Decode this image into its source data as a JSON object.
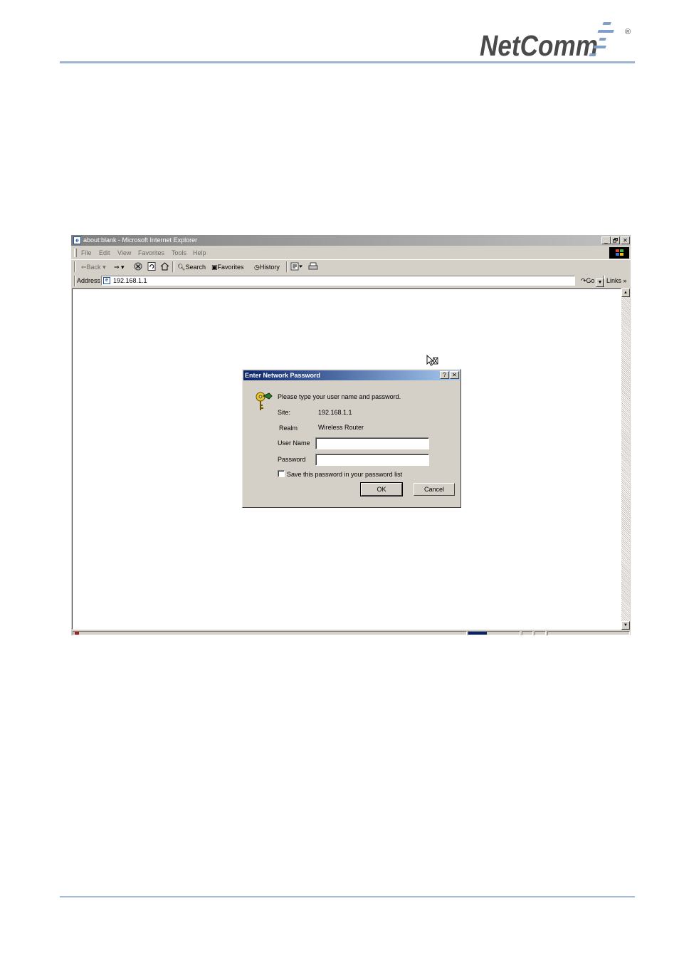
{
  "document": {
    "brand": "NetComm",
    "registered_mark": "®"
  },
  "browser": {
    "title": "about:blank - Microsoft Internet Explorer",
    "window_buttons": {
      "minimize": "_",
      "maximize": "🗗",
      "close": "✕"
    },
    "menu": [
      "File",
      "Edit",
      "View",
      "Favorites",
      "Tools",
      "Help"
    ],
    "toolbar": {
      "back": "Back",
      "search": "Search",
      "favorites": "Favorites",
      "history": "History"
    },
    "address": {
      "label": "Address",
      "value": "192.168.1.1",
      "go": "Go",
      "links": "Links"
    }
  },
  "dialog": {
    "title": "Enter Network Password",
    "help": "?",
    "close": "✕",
    "prompt": "Please type your user name and password.",
    "site_label": "Site:",
    "site_value": "192.168.1.1",
    "realm_label": "Realm",
    "realm_value": "Wireless Router",
    "username_label": "User Name",
    "username_value": "",
    "password_label": "Password",
    "password_value": "",
    "save_password_label": "Save this password in your password list",
    "save_password_checked": false,
    "ok_label": "OK",
    "cancel_label": "Cancel"
  },
  "colors": {
    "brand_gray": "#4a4a4a",
    "brand_blue": "#7f9fc8",
    "rule": "#9db4d3",
    "dialog_title_start": "#0a246a",
    "dialog_title_end": "#a6caf0",
    "window_face": "#d4d0c8"
  }
}
